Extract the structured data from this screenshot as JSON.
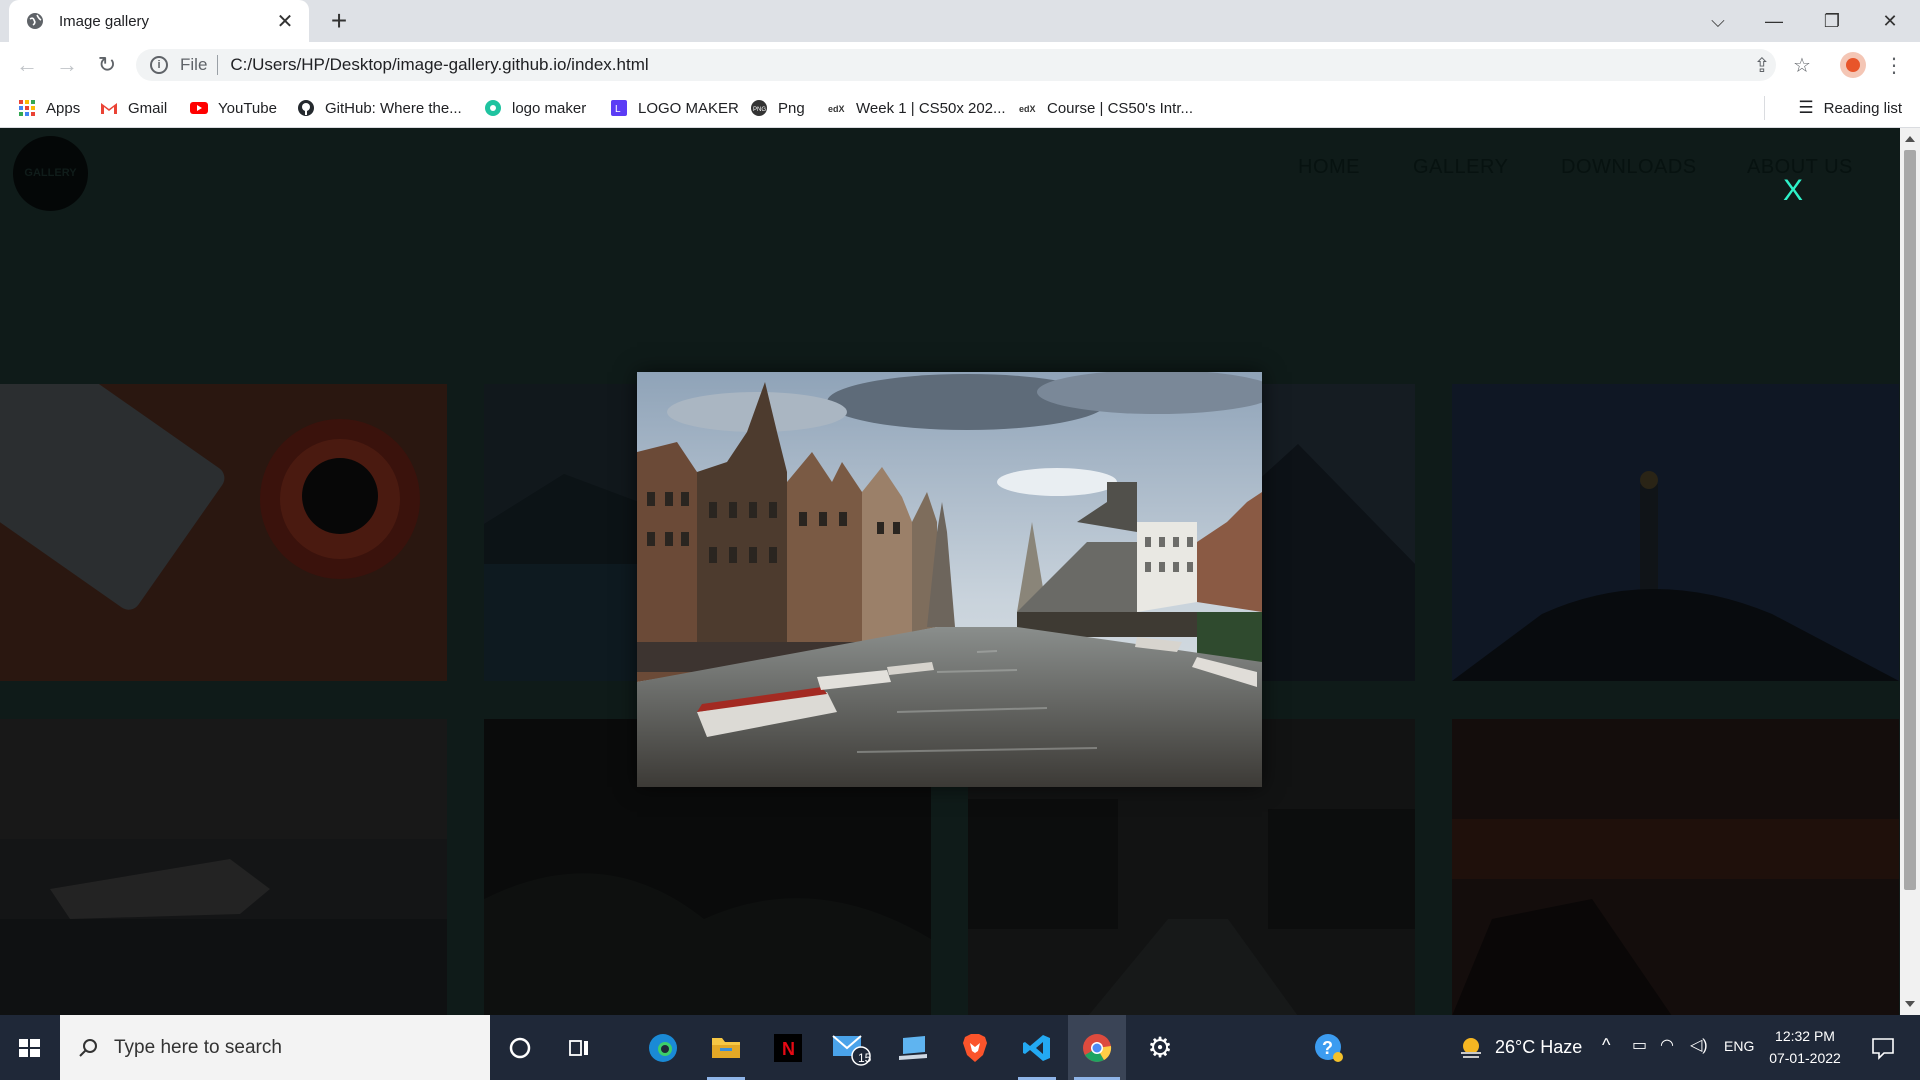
{
  "browser": {
    "tab_title": "Image gallery",
    "omnibox_scheme": "File",
    "url": "C:/Users/HP/Desktop/image-gallery.github.io/index.html",
    "bookmarks": [
      {
        "label": "Apps",
        "icon": "apps-grid-icon"
      },
      {
        "label": "Gmail",
        "icon": "gmail-icon"
      },
      {
        "label": "YouTube",
        "icon": "youtube-icon"
      },
      {
        "label": "GitHub: Where the...",
        "icon": "github-icon"
      },
      {
        "label": "logo maker",
        "icon": "logo-maker-icon"
      },
      {
        "label": "LOGO MAKER",
        "icon": "logo-maker-2-icon"
      },
      {
        "label": "Png",
        "icon": "png-icon"
      },
      {
        "label": "Week 1 | CS50x 202...",
        "icon": "edx-icon"
      },
      {
        "label": "Course | CS50's Intr...",
        "icon": "edx-icon"
      }
    ],
    "reading_list": "Reading list"
  },
  "site": {
    "logo_text": "GALLERY",
    "nav": [
      "HOME",
      "GALLERY",
      "DOWNLOADS",
      "ABOUT US"
    ],
    "close_label": "X"
  },
  "taskbar": {
    "search_placeholder": "Type here to search",
    "mail_badge": "15",
    "weather": "26°C  Haze",
    "language": "ENG",
    "time": "12:32 PM",
    "date": "07-01-2022"
  },
  "colors": {
    "close_accent": "#2ef2c9",
    "page_bg": "#0f1b19",
    "taskbar_bg": "#1f2838"
  }
}
